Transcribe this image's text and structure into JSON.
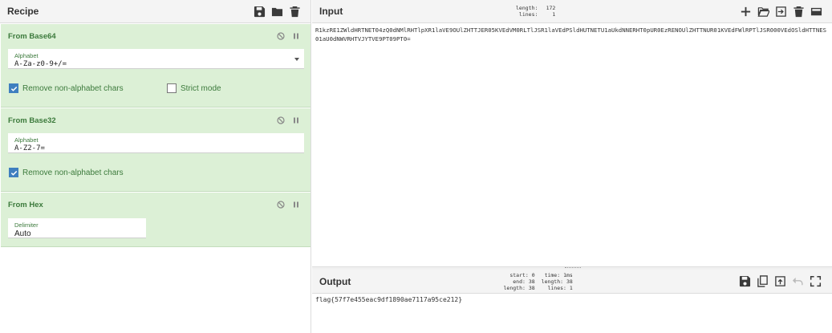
{
  "recipe": {
    "title": "Recipe",
    "icons": [
      "save-icon",
      "folder-icon",
      "trash-icon"
    ],
    "operations": [
      {
        "title": "From Base64",
        "field_label": "Alphabet",
        "field_value": "A-Za-z0-9+/=",
        "check1_label": "Remove non-alphabet chars",
        "check1_checked": true,
        "check2_label": "Strict mode",
        "check2_checked": false
      },
      {
        "title": "From Base32",
        "field_label": "Alphabet",
        "field_value": "A-Z2-7=",
        "check1_label": "Remove non-alphabet chars",
        "check1_checked": true
      },
      {
        "title": "From Hex",
        "field_label": "Delimiter",
        "field_value": "Auto"
      }
    ]
  },
  "input": {
    "title": "Input",
    "length_label": "length:",
    "length_value": "172",
    "lines_label": "lines:",
    "lines_value": "1",
    "text": "R1kzRE1ZWldHRTNET04zQ0dNMlRHTlpXR1laVE9OUlZHTTJER05KVEdVM0RLTlJSR1laVEdPSldHUTNETU1aUkdNNERHT0pUR0EzRENOUlZHTTNUR01KVEdFWlRPTlJSR000VEdOSldHTTNES01aU0dNWVRHTVJYTVE9PT09PT0="
  },
  "output": {
    "title": "Output",
    "start_label": "start:",
    "start_value": "0",
    "end_label": "end:",
    "end_value": "38",
    "length_label": "length:",
    "length_value": "38",
    "time_label": "time:",
    "time_value": "1ms",
    "length2_label": "length:",
    "length2_value": "38",
    "lines_label": "lines:",
    "lines_value": "1",
    "text": "flag{57f7e455eac9df1890ae7117a95ce212}"
  }
}
